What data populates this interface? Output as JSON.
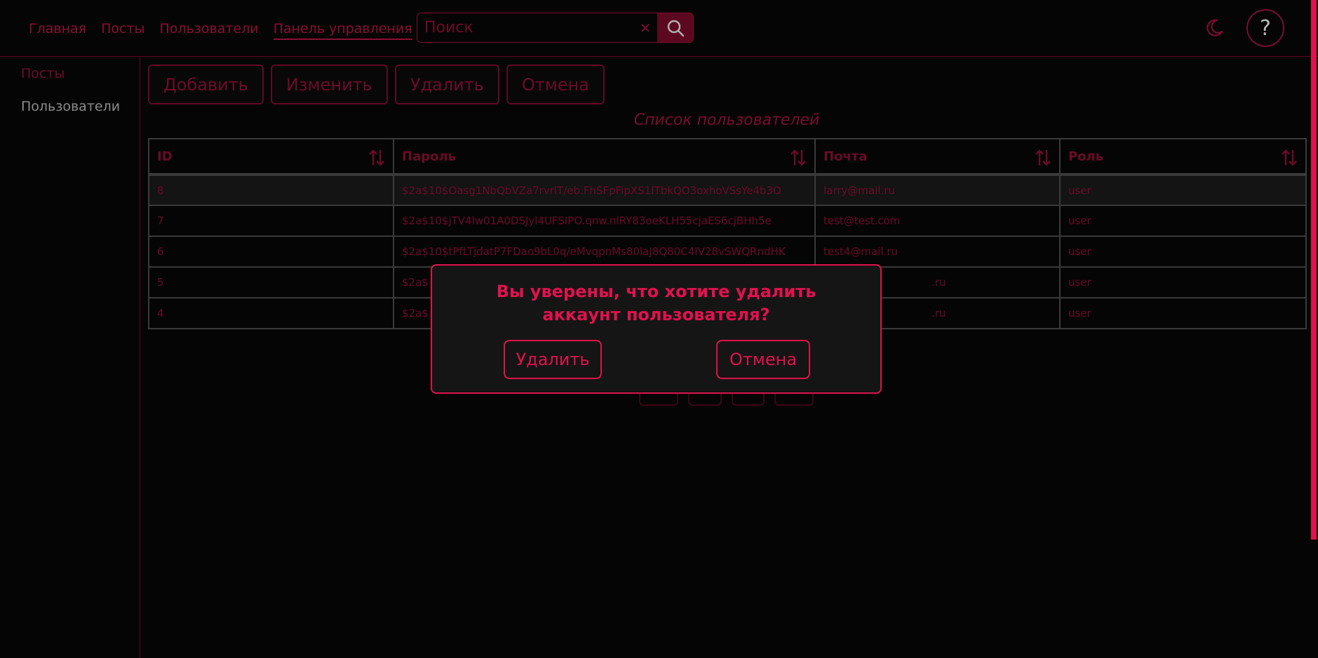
{
  "header": {
    "nav": [
      "Главная",
      "Посты",
      "Пользователи",
      "Панель управления"
    ],
    "active_nav_index": 3,
    "search": {
      "placeholder": "Поиск",
      "value": ""
    },
    "clear_glyph": "✕",
    "help_glyph": "?"
  },
  "sidebar": {
    "items": [
      "Посты",
      "Пользователи"
    ]
  },
  "toolbar": {
    "add_label": "Добавить",
    "edit_label": "Изменить",
    "delete_label": "Удалить",
    "cancel_label": "Отмена"
  },
  "list_title": "Список пользователей",
  "table": {
    "columns": [
      "ID",
      "Пароль",
      "Почта",
      "Роль"
    ],
    "rows": [
      {
        "id": "8",
        "password": "$2a$10$Oasg1NbQbVZa7rvrlT/eb.FhSFpFipXS1ITbkQO3oxhoVSsYe4b3O",
        "email": "larry@mail.ru",
        "role": "user"
      },
      {
        "id": "7",
        "password": "$2a$10$jTV4lw01A0DSJyl4UFSIPO.qnw.nlRY83oeKLH55cjaES6cjBHh5e",
        "email": "test@test.com",
        "role": "user"
      },
      {
        "id": "6",
        "password": "$2a$10$tPfLTjdatP7FDao9bL0q/eMvqpnMs80laJ8Q80C4IV28vSWQRndHK",
        "email": "test4@mail.ru",
        "role": "user"
      },
      {
        "id": "5",
        "password": "$2a$",
        "email": ".ru",
        "role": "user"
      },
      {
        "id": "4",
        "password": "$2a$",
        "email": ".ru",
        "role": "user"
      }
    ]
  },
  "modal": {
    "message": "Вы уверены, что хотите удалить аккаунт пользователя?",
    "confirm_label": "Удалить",
    "cancel_label": "Отмена"
  },
  "colors": {
    "accent": "#e0124e",
    "accent_dim": "#6e0b29",
    "background": "#050505",
    "modal_bg": "#151515"
  },
  "icons": [
    "search-icon",
    "moon-icon",
    "sort-icon",
    "close-icon"
  ]
}
